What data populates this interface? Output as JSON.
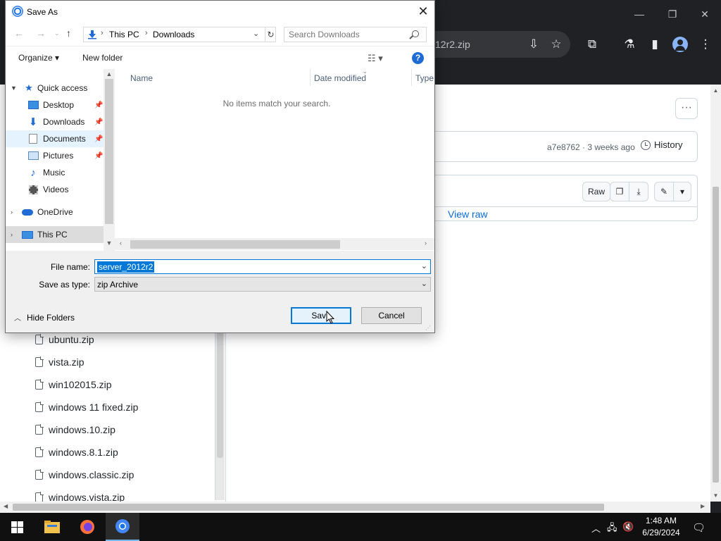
{
  "browser": {
    "url_fragment": "12r2.zip",
    "window_controls": {
      "minimize": "—",
      "maximize": "❐",
      "close": "✕"
    },
    "commit_info": "a7e8762 · 3 weeks ago",
    "history_label": "History",
    "raw_label": "Raw",
    "view_raw_label": "View raw",
    "more_label": "···",
    "file_list": [
      "ubuntu.zip",
      "vista.zip",
      "win102015.zip",
      "windows 11 fixed.zip",
      "windows.10.zip",
      "windows.8.1.zip",
      "windows.classic.zip",
      "windows.vista.zip"
    ]
  },
  "dialog": {
    "title": "Save As",
    "breadcrumb": [
      "This PC",
      "Downloads"
    ],
    "search_placeholder": "Search Downloads",
    "organize_label": "Organize ▾",
    "new_folder_label": "New folder",
    "nav_items": [
      {
        "label": "Quick access",
        "icon": "star-icon",
        "level": 0,
        "expanded": true
      },
      {
        "label": "Desktop",
        "icon": "desktop-icon",
        "level": 1,
        "pinned": true
      },
      {
        "label": "Downloads",
        "icon": "download-icon",
        "level": 1,
        "pinned": true
      },
      {
        "label": "Documents",
        "icon": "document-icon",
        "level": 1,
        "pinned": true,
        "selected": true
      },
      {
        "label": "Pictures",
        "icon": "pictures-icon",
        "level": 1,
        "pinned": true
      },
      {
        "label": "Music",
        "icon": "music-icon",
        "level": 1
      },
      {
        "label": "Videos",
        "icon": "video-icon",
        "level": 1
      },
      {
        "label": "OneDrive",
        "icon": "cloud-icon",
        "level": 0
      },
      {
        "label": "This PC",
        "icon": "computer-icon",
        "level": 0,
        "highlighted": true
      }
    ],
    "columns": [
      "Name",
      "Date modified",
      "Type"
    ],
    "empty_message": "No items match your search.",
    "file_name_label": "File name:",
    "file_name_value": "server_2012r2",
    "save_type_label": "Save as type:",
    "save_type_value": "zip Archive",
    "hide_folders_label": "Hide Folders",
    "save_label": "Save",
    "cancel_label": "Cancel"
  },
  "taskbar": {
    "time": "1:48 AM",
    "date": "6/29/2024",
    "apps": [
      "windows-start-icon",
      "file-explorer-icon",
      "firefox-icon",
      "chrome-icon"
    ]
  },
  "colors": {
    "accent": "#0078d7",
    "browser_dark": "#202124",
    "link": "#0969da"
  }
}
